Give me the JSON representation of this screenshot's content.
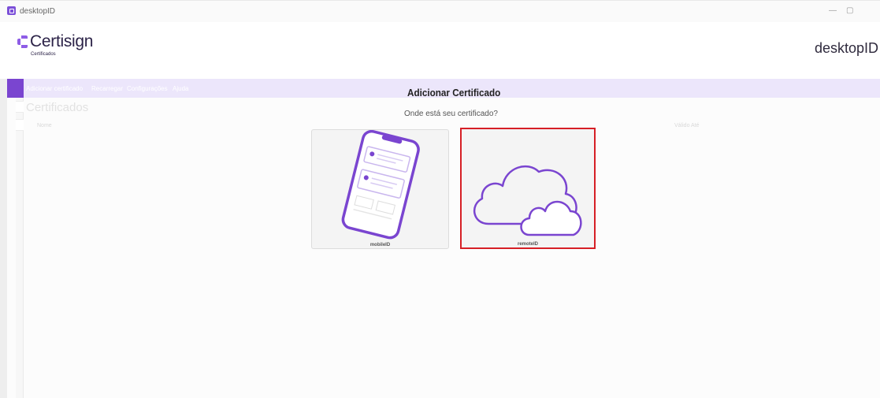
{
  "window": {
    "title": "desktopID",
    "minimize_glyph": "—",
    "restore_glyph": "▢"
  },
  "header": {
    "brand": "Certisign",
    "brand_sub": "Certificados",
    "product": "desktopID"
  },
  "menu": {
    "items": [
      "Adicionar certificado",
      "Recarregar",
      "Configurações",
      "Ajuda"
    ]
  },
  "page": {
    "title": "Certificados",
    "columns": [
      "Nome",
      "Válido Até"
    ]
  },
  "dialog": {
    "title": "Adicionar Certificado",
    "subtitle": "Onde está seu certificado?",
    "options": [
      {
        "label": "mobileID",
        "icon": "smartphone-icon",
        "selected": false
      },
      {
        "label": "remoteID",
        "icon": "cloud-icon",
        "selected": true
      }
    ]
  },
  "colors": {
    "accent": "#7a45d0",
    "menubar": "#ece6fb",
    "selection_border": "#d61f26"
  }
}
